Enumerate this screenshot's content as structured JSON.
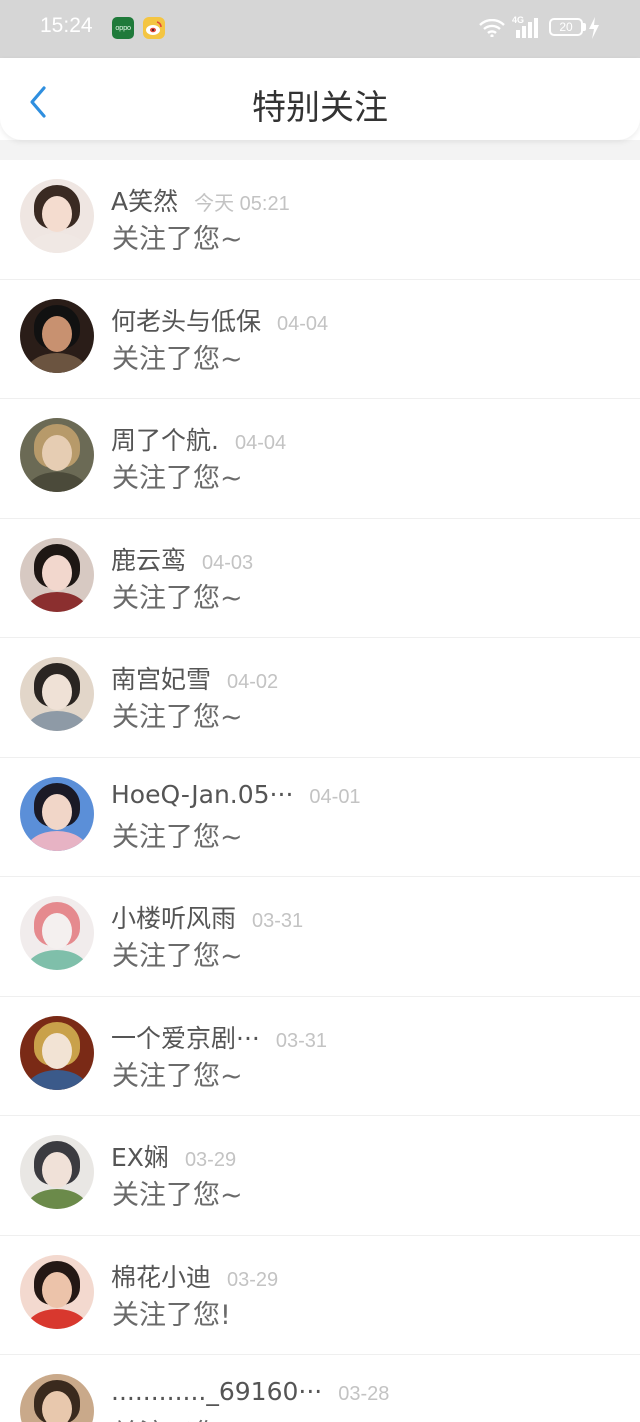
{
  "status_bar": {
    "time": "15:24",
    "app_icon_1": "oppo",
    "network": "4G",
    "battery": "20"
  },
  "header": {
    "title": "特别关注",
    "back_icon": "chevron-left-icon"
  },
  "colors": {
    "status_bar_bg": "#d6d6d6",
    "back_arrow": "#2f8fdf",
    "name_text": "#555555",
    "date_text": "#c3c3c3",
    "message_text": "#6a6a6a"
  },
  "items": [
    {
      "name": "A笑然",
      "date": "今天 05:21",
      "message": "关注了您~",
      "avatar": {
        "bg": "#efe6e2",
        "hair": "#3a2a22",
        "face": "#f4dccf",
        "body": "#f0e8e4"
      }
    },
    {
      "name": "何老头与低保",
      "date": "04-04",
      "message": "关注了您~",
      "avatar": {
        "bg": "#2a1d18",
        "hair": "#111111",
        "face": "#c89170",
        "body": "#6b5440"
      }
    },
    {
      "name": "周了个航.",
      "date": "04-04",
      "message": "关注了您~",
      "avatar": {
        "bg": "#6b6a55",
        "hair": "#b79a6a",
        "face": "#e6cdb3",
        "body": "#4b4a3a"
      }
    },
    {
      "name": "鹿云鸾",
      "date": "04-03",
      "message": "关注了您~",
      "avatar": {
        "bg": "#d7c9c2",
        "hair": "#1e1714",
        "face": "#f2d7cd",
        "body": "#8b2f2f"
      }
    },
    {
      "name": "南宫妃雪",
      "date": "04-02",
      "message": "关注了您~",
      "avatar": {
        "bg": "#e2d6c9",
        "hair": "#2a2522",
        "face": "#efe1d6",
        "body": "#8e9aa6"
      }
    },
    {
      "name": "HoeQ-Jan.05···",
      "date": "04-01",
      "message": "关注了您~",
      "avatar": {
        "bg": "#5b8fd8",
        "hair": "#1b1a26",
        "face": "#f1d6c8",
        "body": "#e7b3c4"
      }
    },
    {
      "name": "小楼听风雨",
      "date": "03-31",
      "message": "关注了您~",
      "avatar": {
        "bg": "#f1ecec",
        "hair": "#e58a8e",
        "face": "#f4f0ef",
        "body": "#7fbfaa"
      }
    },
    {
      "name": "一个爱京剧···",
      "date": "03-31",
      "message": "关注了您~",
      "avatar": {
        "bg": "#7a2a16",
        "hair": "#c9a14a",
        "face": "#f2e3d4",
        "body": "#3b5a8a"
      }
    },
    {
      "name": "EX娴",
      "date": "03-29",
      "message": "关注了您~",
      "avatar": {
        "bg": "#e9e7e4",
        "hair": "#3b3b40",
        "face": "#f0e1d8",
        "body": "#6b8a4a"
      }
    },
    {
      "name": "棉花小迪",
      "date": "03-29",
      "message": "关注了您!",
      "avatar": {
        "bg": "#f3d9cf",
        "hair": "#241815",
        "face": "#ecc3aa",
        "body": "#d8382e"
      }
    },
    {
      "name": "............_69160···",
      "date": "03-28",
      "message": "关注了您!",
      "avatar": {
        "bg": "#c9a98a",
        "hair": "#3a2a1e",
        "face": "#e8c8ad",
        "body": "#b48a6a"
      }
    }
  ]
}
